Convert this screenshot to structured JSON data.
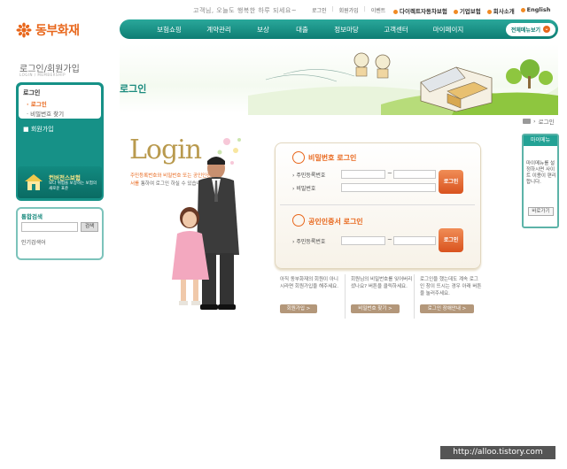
{
  "header": {
    "greeting": "고객님, 오늘도 행복한 하루 되세요~",
    "util_links": [
      "로그인",
      "회원가입",
      "이벤트"
    ],
    "util_right": [
      "다이렉트자동차보험",
      "기업보험",
      "회사소개",
      "English"
    ],
    "logo_text": "동부화재",
    "brand_color": "#e8671c",
    "accent_color": "#1a8a7e"
  },
  "nav": {
    "items": [
      "보험쇼핑",
      "계약관리",
      "보상",
      "대출",
      "정보마당",
      "고객센터",
      "마이페이지"
    ],
    "all_menu": "전체메뉴보기"
  },
  "sidebar": {
    "title": "로그인/회원가입",
    "subtitle": "LOGIN / MEMBERSHIP",
    "group": "로그인",
    "items": [
      "로그인",
      "비밀번호 찾기"
    ],
    "member": "회원가입",
    "banner_title": "컨버전스보험",
    "banner_text": "보다 위험을 보장하는 보험의 새로운 표준",
    "search_title": "통합검색",
    "search_button": "검색",
    "popular": "인기검색어"
  },
  "page": {
    "title": "로그인",
    "breadcrumb": "로그인"
  },
  "quick_menu": {
    "title": "마이메뉴",
    "text": "마이메뉴를 설정하시면 사이트 이용이 편리합니다.",
    "button": "바로가기"
  },
  "login": {
    "hero": "Login",
    "desc_hl": "주민등록번호와 비밀번호 또는 공인인증서를",
    "desc": "통하여 로그인 하실 수 있습니다.",
    "pw_title": "비밀번호 로그인",
    "rrn_label": "주민등록번호",
    "pw_label": "비밀번호",
    "login_button": "로그인",
    "cert_title": "공인인증서 로그인",
    "cert_rrn_label": "주민등록번호",
    "cert_button": "로그인"
  },
  "help": [
    {
      "text": "아직 동부화재의 회원이 아니시라면 회원가입을 해주세요.",
      "button": "회원가입 >"
    },
    {
      "text": "회원님의 비밀번호를 잊어버리셨나요? 버튼을 클릭하세요.",
      "button": "비밀번호 찾기 >"
    },
    {
      "text": "로그인을 했는데도 계속 로그인 창이 뜨시는 경우 아래 버튼을 눌러주세요.",
      "button": "로그인 장애안내 >"
    }
  ],
  "watermark": "http://alloo.tistory.com"
}
